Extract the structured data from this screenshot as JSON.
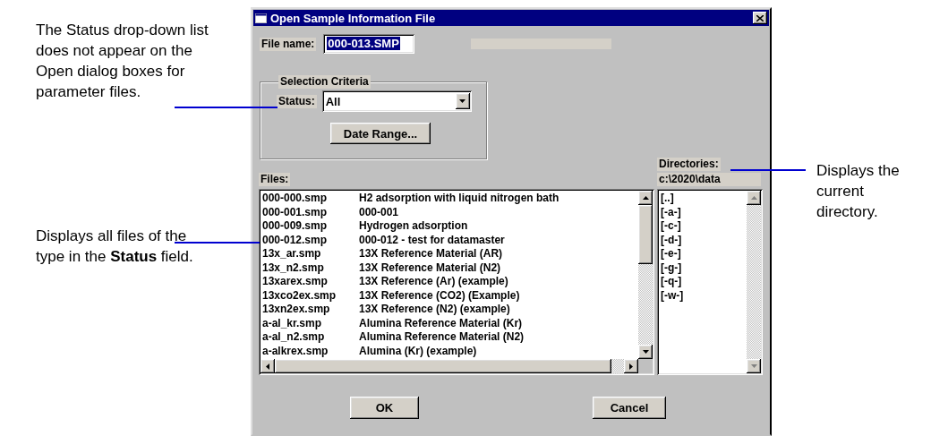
{
  "annotations": [
    {
      "text": "The Status drop-down list does not appear on the Open dialog boxes for parameter files."
    },
    {
      "text": "Displays all files of the type in the **Status** field."
    },
    {
      "text": "Displays the current directory."
    }
  ],
  "dialog": {
    "title": "Open Sample Information File",
    "file_name": {
      "label": "File name:",
      "value": "000-013.SMP",
      "selected": true
    },
    "selection_criteria": {
      "title": "Selection Criteria",
      "status_label": "Status:",
      "status_value": "All",
      "date_range_button": "Date Range..."
    },
    "files": {
      "label": "Files:",
      "rows": [
        {
          "name": "000-000.smp",
          "description": "H2 adsorption with liquid nitrogen bath"
        },
        {
          "name": "000-001.smp",
          "description": "000-001"
        },
        {
          "name": "000-009.smp",
          "description": "Hydrogen adsorption"
        },
        {
          "name": "000-012.smp",
          "description": "000-012 - test for datamaster"
        },
        {
          "name": "13x_ar.smp",
          "description": "13X Reference Material (AR)"
        },
        {
          "name": "13x_n2.smp",
          "description": "13X Reference Material (N2)"
        },
        {
          "name": "13xarex.smp",
          "description": "13X Reference (Ar) (example)"
        },
        {
          "name": "13xco2ex.smp",
          "description": "13X Reference (CO2) (Example)"
        },
        {
          "name": "13xn2ex.smp",
          "description": "13X Reference (N2) (example)"
        },
        {
          "name": "a-al_kr.smp",
          "description": "Alumina Reference Material (Kr)"
        },
        {
          "name": "a-al_n2.smp",
          "description": "Alumina Reference Material (N2)"
        },
        {
          "name": "a-alkrex.smp",
          "description": "Alumina (Kr) (example)"
        }
      ]
    },
    "directories": {
      "label": "Directories:",
      "path": "c:\\2020\\data",
      "items": [
        "[..]",
        "[-a-]",
        "[-c-]",
        "[-d-]",
        "[-e-]",
        "[-g-]",
        "[-q-]",
        "[-w-]"
      ]
    },
    "buttons": [
      "OK",
      "Cancel"
    ]
  }
}
